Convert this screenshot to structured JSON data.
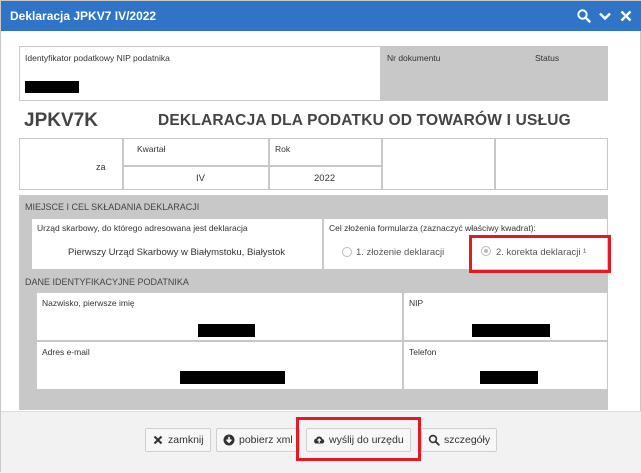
{
  "dialog": {
    "title": "Deklaracja JPKV7 IV/2022",
    "icons": [
      "search-icon",
      "chevron-down-icon",
      "close-icon"
    ]
  },
  "form": {
    "nip_label": "Identyfikator podatkowy NIP podatnika",
    "doc_number_label": "Nr dokumentu",
    "status_label": "Status",
    "code": "JPKV7K",
    "heading": "DEKLARACJA DLA PODATKU OD TOWARÓW I USŁUG",
    "za_label": "za",
    "quarter_label": "Kwartał",
    "quarter_value": "IV",
    "year_label": "Rok",
    "year_value": "2022",
    "section_place": "MIEJSCE I CEL SKŁADANIA DEKLARACJI",
    "office_label": "Urząd skarbowy, do którego adresowana jest deklaracja",
    "office_value": "Pierwszy Urząd Skarbowy w Białymstoku, Białystok",
    "purpose_label": "Cel złożenia formularza (zaznaczyć właściwy kwadrat):",
    "purpose_options": [
      "1. złożenie deklaracji",
      "2. korekta deklaracji ¹"
    ],
    "purpose_selected": "2. korekta deklaracji ¹",
    "section_identity": "DANE IDENTYFIKACYJNE PODATNIKA",
    "name_label": "Nazwisko, pierwsze imię",
    "nip2_label": "NIP",
    "email_label": "Adres e-mail",
    "phone_label": "Telefon"
  },
  "footer": {
    "close_label": "zamknij",
    "download_label": "pobierz xml",
    "send_label": "wyślij do urzędu",
    "details_label": "szczegóły"
  },
  "colors": {
    "titlebar": "#2f74c6",
    "highlight": "#e01b24",
    "section_gray": "#c8c8c8"
  }
}
